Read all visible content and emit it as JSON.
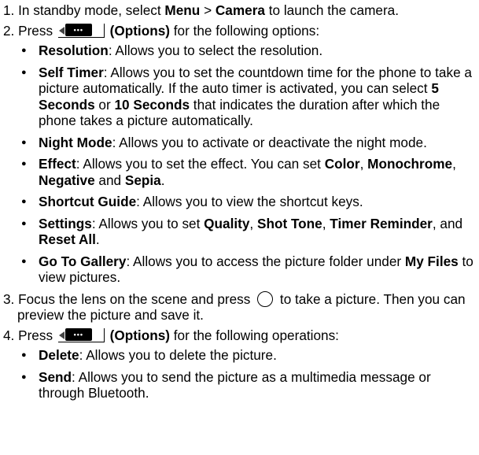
{
  "step1": {
    "num": "1.",
    "t1": " In standby mode, select ",
    "b1": "Menu",
    "t2": " > ",
    "b2": "Camera",
    "t3": " to launch the camera."
  },
  "step2": {
    "num": "2.",
    "t1": " Press ",
    "b1": "(Options)",
    "t2": " for the following options:",
    "key_dots": "•••"
  },
  "options": [
    {
      "b": "Resolution",
      "t": ": Allows you to select the resolution."
    },
    {
      "b": "Self Timer",
      "t1": ": Allows you to set the countdown time for the phone to take a picture automatically. If the auto timer is activated, you can select ",
      "b2": "5 Seconds",
      "t2": " or ",
      "b3": "10 Seconds",
      "t3": " that indicates the duration after which the phone takes a picture automatically."
    },
    {
      "b": "Night Mode",
      "t": ": Allows you to activate or deactivate the night mode."
    },
    {
      "b": "Effect",
      "t1": ": Allows you to set the effect. You can set ",
      "b2": "Color",
      "t2": ", ",
      "b3": "Monochrome",
      "t3": ", ",
      "b4": "Negative",
      "t4": " and ",
      "b5": "Sepia",
      "t5": "."
    },
    {
      "b": "Shortcut Guide",
      "t": ": Allows you to view the shortcut keys."
    },
    {
      "b": "Settings",
      "t1": ": Allows you to set ",
      "b2": "Quality",
      "t2": ", ",
      "b3": "Shot Tone",
      "t3": ", ",
      "b4": "Timer Reminder",
      "t4": ", and ",
      "b5": "Reset All",
      "t5": "."
    },
    {
      "b": "Go To Gallery",
      "t1": ": Allows you to access the picture folder under ",
      "b2": "My Files",
      "t2": " to view pictures."
    }
  ],
  "step3": {
    "num": "3.",
    "t1": " Focus the lens on the scene and press ",
    "t2": " to take a picture. Then you can preview the picture and save it."
  },
  "step4": {
    "num": "4.",
    "t1": " Press ",
    "b1": "(Options)",
    "t2": " for the following operations:",
    "key_dots": "•••"
  },
  "operations": [
    {
      "b": "Delete",
      "t": ": Allows you to delete the picture."
    },
    {
      "b": "Send",
      "t": ": Allows you to send the picture as a multimedia message or through Bluetooth."
    }
  ]
}
